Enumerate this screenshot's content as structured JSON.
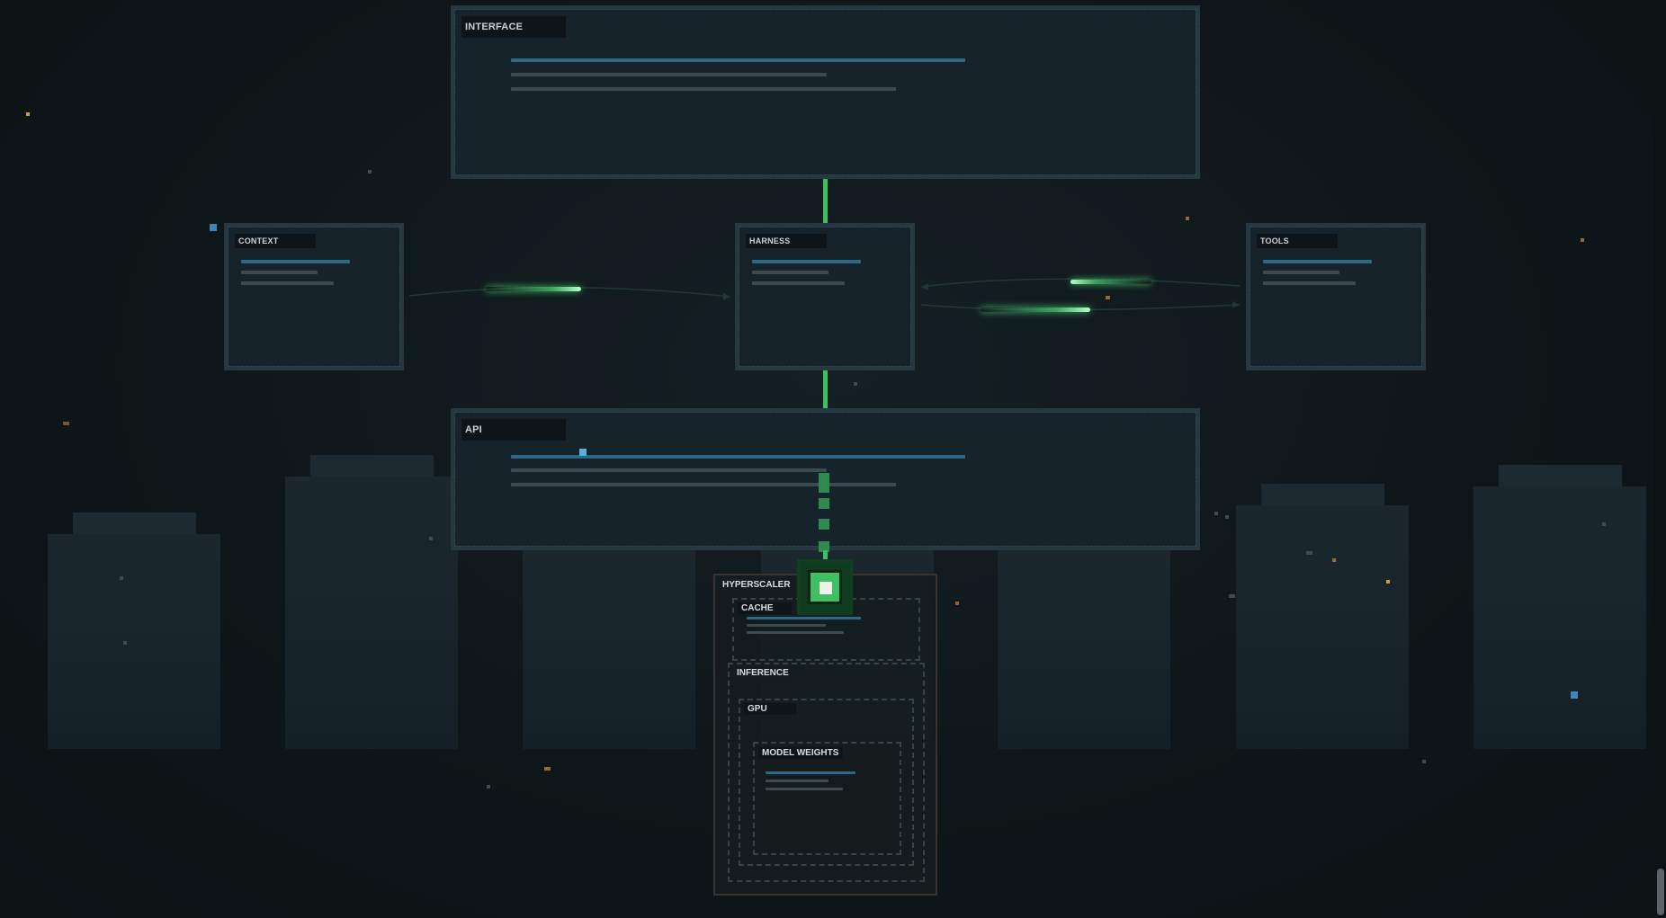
{
  "diagram": {
    "interface": {
      "label": "INTERFACE"
    },
    "context": {
      "label": "CONTEXT"
    },
    "harness": {
      "label": "HARNESS"
    },
    "tools": {
      "label": "TOOLS"
    },
    "api": {
      "label": "API"
    },
    "hyperscaler": {
      "label": "HYPERSCALER",
      "cache": {
        "label": "CACHE"
      },
      "inference": {
        "label": "INFERENCE"
      },
      "gpu": {
        "label": "GPU"
      },
      "model_weights": {
        "label": "MODEL WEIGHTS"
      }
    }
  },
  "colors": {
    "accent_green": "#3ebf63",
    "bar_blue": "#2b6a86",
    "bar_grey": "#3b4b50",
    "panel_bg": "#17232a",
    "panel_border": "#263840"
  }
}
